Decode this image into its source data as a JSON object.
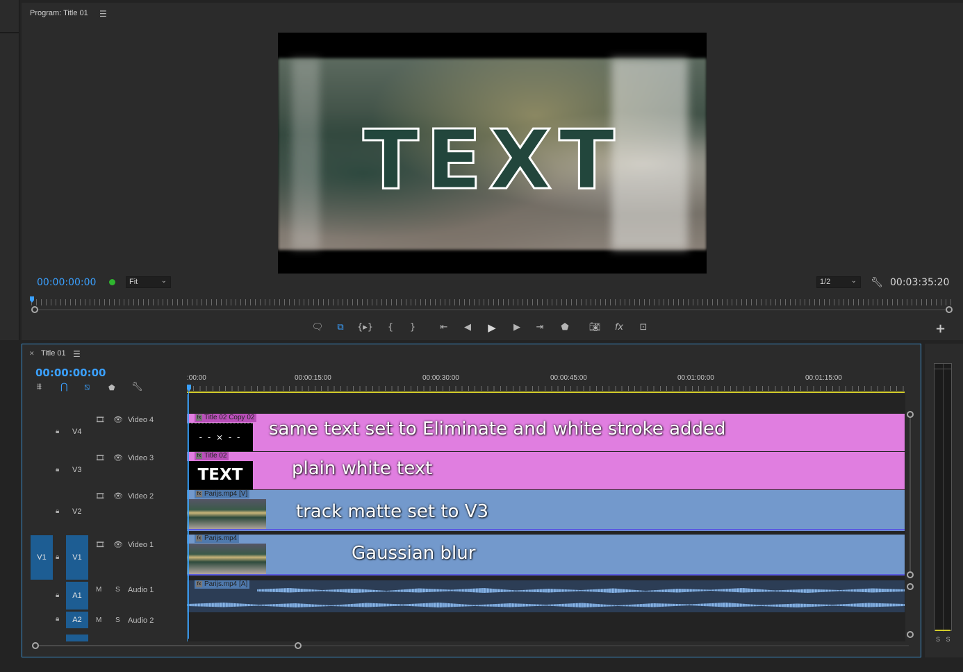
{
  "program": {
    "title": "Program: Title 01",
    "preview_text": "TEXT",
    "timecode_current": "00:00:00:00",
    "timecode_duration": "00:03:35:20",
    "zoom": "Fit",
    "resolution": "1/2"
  },
  "transport": {
    "icons": [
      "marker-icon",
      "in-out-icon",
      "trim-icon",
      "mark-in-icon",
      "mark-out-icon",
      "go-to-in-icon",
      "step-back-icon",
      "play-icon",
      "step-forward-icon",
      "go-to-out-icon",
      "lift-icon",
      "export-frame-icon",
      "fx-icon",
      "comparison-view-icon"
    ]
  },
  "timeline": {
    "tab_title": "Title 01",
    "timecode": "00:00:00:00",
    "ruler_labels": [
      ":00:00",
      "00:00:15:00",
      "00:00:30:00",
      "00:00:45:00",
      "00:01:00:00",
      "00:01:15:00"
    ],
    "tracks": {
      "v4": {
        "id": "V4",
        "name": "Video 4"
      },
      "v3": {
        "id": "V3",
        "name": "Video 3"
      },
      "v2": {
        "id": "V2",
        "name": "Video 2"
      },
      "v1": {
        "id": "V1",
        "name": "Video 1",
        "source": "V1"
      },
      "a1": {
        "id": "A1",
        "name": "Audio 1",
        "m": "M",
        "s": "S"
      },
      "a2": {
        "id": "A2",
        "name": "Audio 2",
        "m": "M",
        "s": "S"
      }
    },
    "clips": {
      "v4": {
        "name": "Title 02 Copy 02",
        "annotation": "same text set to Eliminate and white stroke added"
      },
      "v3": {
        "name": "Title 02",
        "annotation": "plain white text",
        "thumb_text": "TEXT"
      },
      "v2": {
        "name": "Parijs.mp4 [V]",
        "annotation": "track matte set to V3"
      },
      "v1": {
        "name": "Parijs.mp4",
        "annotation": "Gaussian blur"
      },
      "a1": {
        "name": "Parijs.mp4 [A]"
      }
    },
    "fx_badge": "fx"
  },
  "meter": {
    "solo_labels": "S S"
  },
  "colors": {
    "accent_blue": "#3aa0ff",
    "title_clip": "#e07ee0",
    "video_clip": "#7399cc",
    "panel_bg": "#2b2b2b",
    "work_area": "#d4cd2a"
  }
}
